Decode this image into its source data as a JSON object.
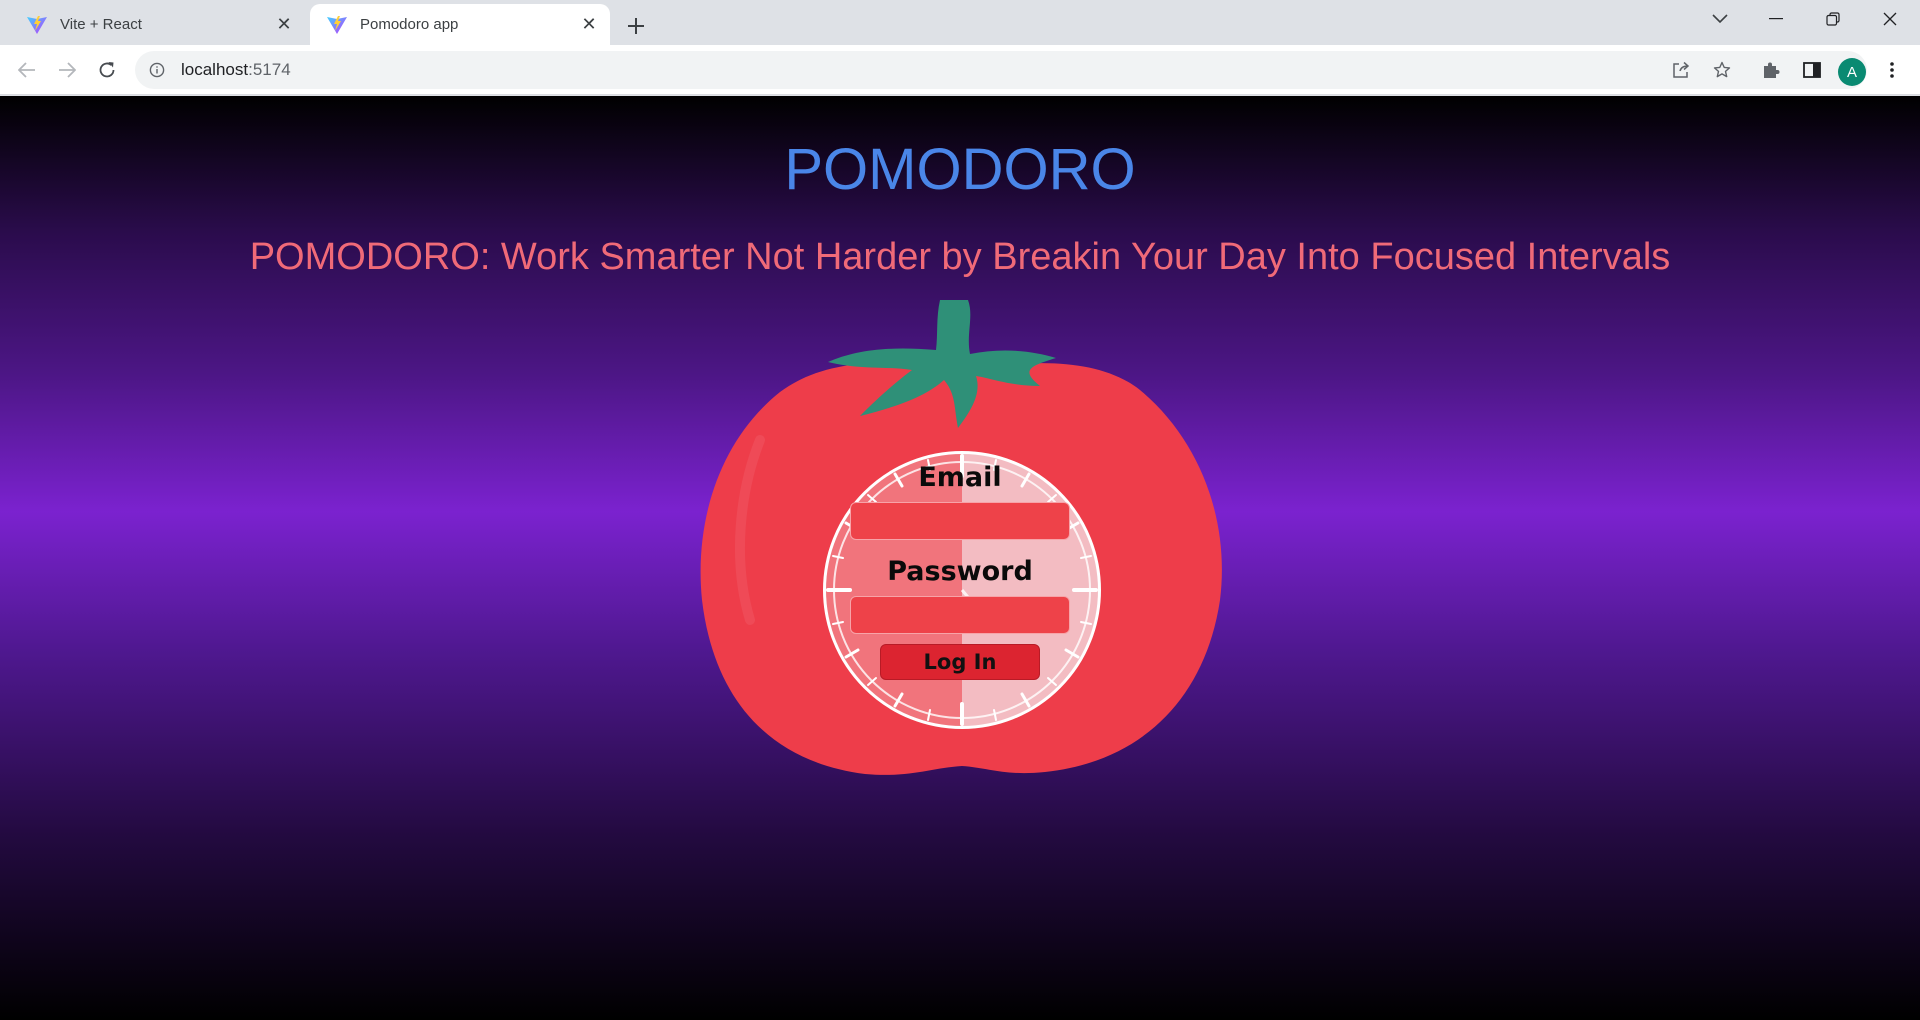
{
  "browser": {
    "tabs": [
      {
        "title": "Vite + React",
        "active": false,
        "favicon": "vite-icon"
      },
      {
        "title": "Pomodoro app",
        "active": true,
        "favicon": "vite-icon"
      }
    ],
    "url_host": "localhost",
    "url_port": ":5174",
    "profile_initial": "A",
    "profile_color": "#0a8a72"
  },
  "page": {
    "title": "POMODORO",
    "subtitle": "POMODORO: Work Smarter Not Harder by Breakin Your Day Into Focused Intervals",
    "title_color": "#4a86e8",
    "subtitle_color": "#f06a78"
  },
  "login": {
    "email_label": "Email",
    "email_value": "",
    "password_label": "Password",
    "password_value": "",
    "submit_label": "Log In"
  },
  "colors": {
    "tomato": "#ee3d4a",
    "leaf": "#2f9078",
    "background_accent": "#7b22cf"
  }
}
